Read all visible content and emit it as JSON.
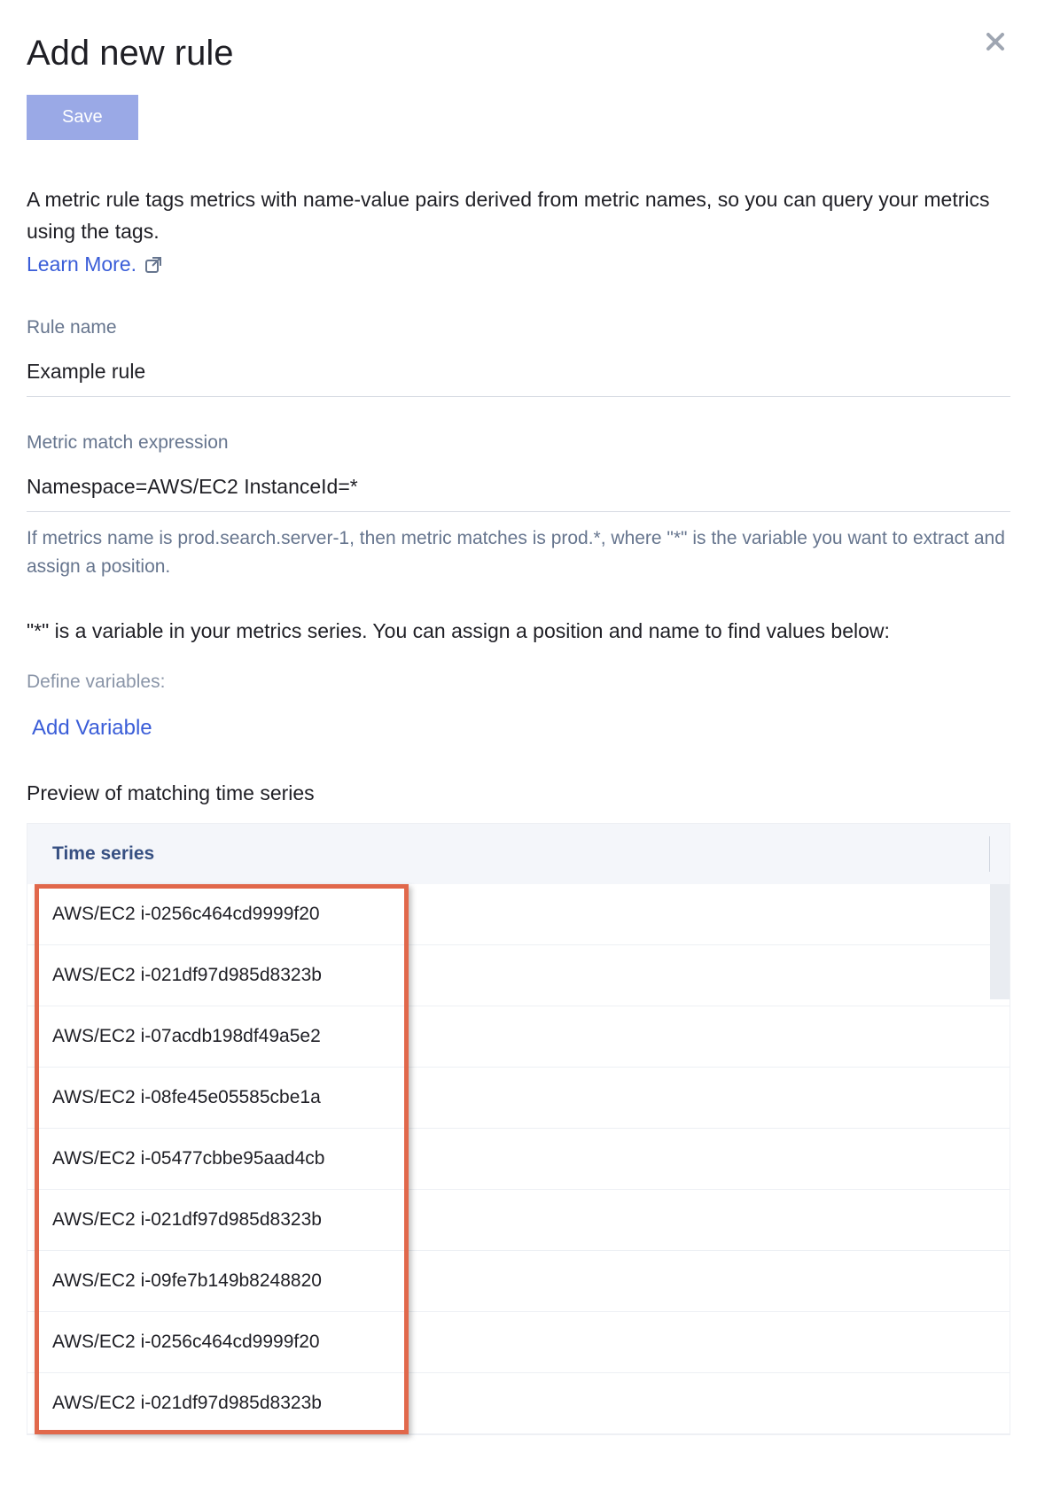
{
  "header": {
    "title": "Add new rule",
    "save_label": "Save"
  },
  "intro": {
    "text": "A metric rule tags metrics with name-value pairs derived from metric names, so you can query your metrics using the tags.",
    "learn_more_label": "Learn More."
  },
  "fields": {
    "rule_name": {
      "label": "Rule name",
      "value": "Example rule"
    },
    "match_expression": {
      "label": "Metric match expression",
      "value": "Namespace=AWS/EC2 InstanceId=*",
      "helper": "If metrics name is prod.search.server-1, then metric matches is prod.*, where \"*\" is the variable you want to extract and assign a position."
    }
  },
  "variables": {
    "info_text": "\"*\" is a variable in your metrics series. You can assign a position and name to find values below:",
    "define_label": "Define variables:",
    "add_label": "Add Variable"
  },
  "preview": {
    "heading": "Preview of matching time series",
    "column_header": "Time series",
    "rows": [
      "AWS/EC2 i-0256c464cd9999f20",
      "AWS/EC2 i-021df97d985d8323b",
      "AWS/EC2 i-07acdb198df49a5e2",
      "AWS/EC2 i-08fe45e05585cbe1a",
      "AWS/EC2 i-05477cbbe95aad4cb",
      "AWS/EC2 i-021df97d985d8323b",
      "AWS/EC2 i-09fe7b149b8248820",
      "AWS/EC2 i-0256c464cd9999f20",
      "AWS/EC2 i-021df97d985d8323b"
    ]
  }
}
